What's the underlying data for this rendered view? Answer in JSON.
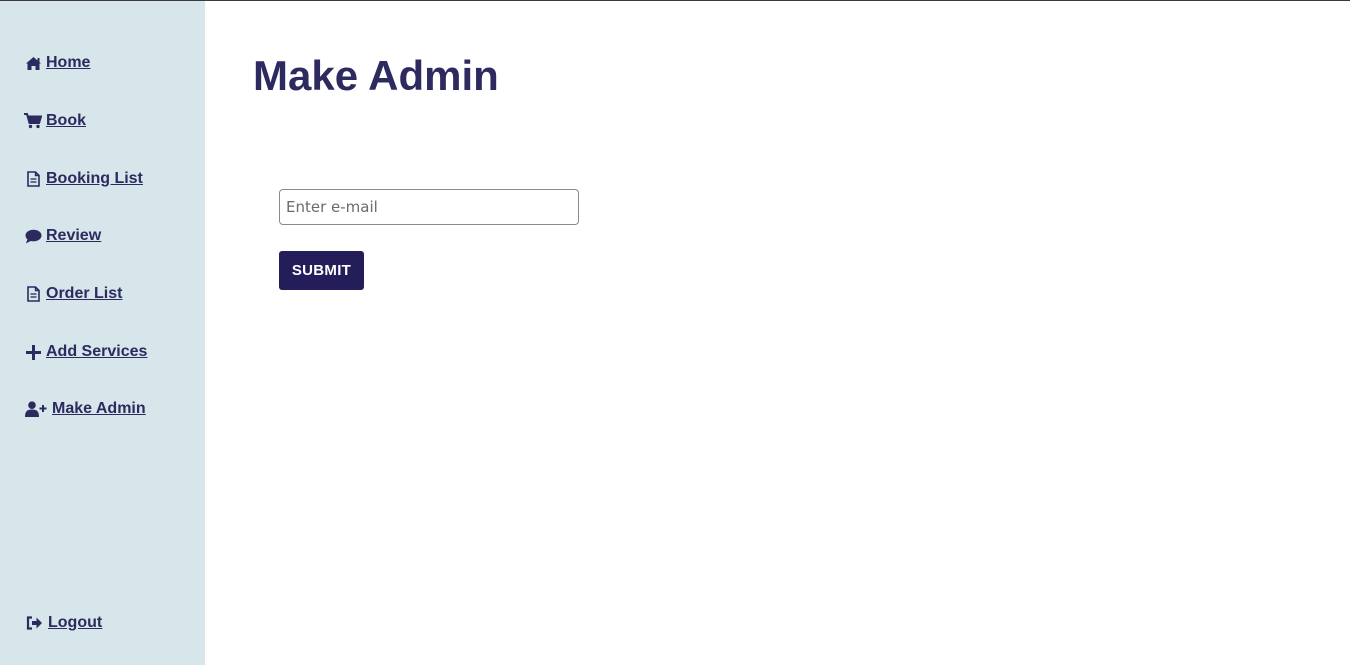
{
  "sidebar": {
    "items": [
      {
        "label": "Home",
        "icon": "home-icon"
      },
      {
        "label": "Book",
        "icon": "cart-icon"
      },
      {
        "label": "Booking List",
        "icon": "document-icon"
      },
      {
        "label": "Review",
        "icon": "comment-icon"
      },
      {
        "label": "Order List",
        "icon": "document-icon"
      },
      {
        "label": "Add Services",
        "icon": "plus-icon"
      },
      {
        "label": "Make Admin",
        "icon": "user-plus-icon"
      }
    ],
    "logout": {
      "label": "Logout",
      "icon": "sign-out-icon"
    }
  },
  "main": {
    "title": "Make Admin",
    "email": {
      "placeholder": "Enter e-mail",
      "value": ""
    },
    "submit_label": "SUBMIT"
  },
  "colors": {
    "sidebar_bg": "#d6e6ea",
    "accent": "#2c2a5e",
    "button_bg": "#231e5a"
  }
}
